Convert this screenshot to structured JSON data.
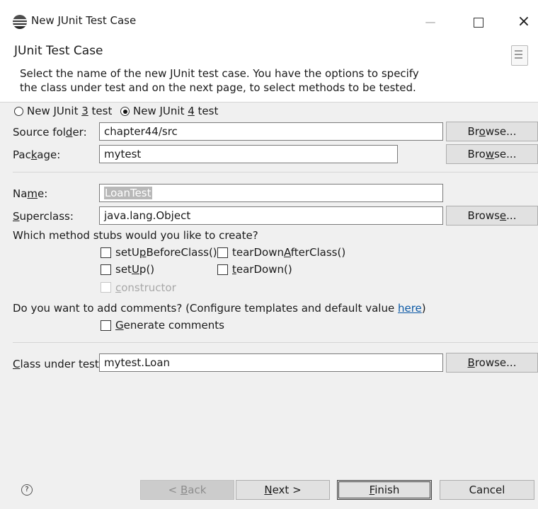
{
  "window": {
    "title": "New JUnit Test Case",
    "min_glyph": "—",
    "close_glyph": "×"
  },
  "header": {
    "title": "JUnit Test Case",
    "description": [
      "Select the name of the new JUnit test case. You have the options to specify",
      "the class under test and on the next page, to select methods to be tested."
    ]
  },
  "version": {
    "junit3": {
      "pre": "New JUnit ",
      "mn": "3",
      "post": " test",
      "selected": false
    },
    "junit4": {
      "pre": "New JUnit ",
      "mn": "4",
      "post": " test",
      "selected": true
    }
  },
  "fields": {
    "source_folder": {
      "label_pre": "Source fol",
      "label_mn": "d",
      "label_post": "er:",
      "value": "chapter44/src",
      "browse": {
        "pre": "Br",
        "mn": "o",
        "post": "wse..."
      }
    },
    "package": {
      "label_pre": "Pac",
      "label_mn": "k",
      "label_post": "age:",
      "value": "mytest",
      "browse": {
        "pre": "Bro",
        "mn": "w",
        "post": "se..."
      }
    },
    "name": {
      "label_pre": "Na",
      "label_mn": "m",
      "label_post": "e:",
      "value": "LoanTest"
    },
    "superclass": {
      "label_pre": "",
      "label_mn": "S",
      "label_post": "uperclass:",
      "value": "java.lang.Object",
      "browse": {
        "pre": "Brows",
        "mn": "e",
        "post": "..."
      }
    },
    "class_under_test": {
      "label_pre": "",
      "label_mn": "C",
      "label_post": "lass under test:",
      "value": "mytest.Loan",
      "browse": {
        "pre": "",
        "mn": "B",
        "post": "rowse..."
      }
    }
  },
  "stubs": {
    "question": "Which method stubs would you like to create?",
    "setUpBeforeClass": {
      "pre": "setU",
      "mn": "p",
      "post": "BeforeClass()",
      "checked": false
    },
    "tearDownAfterClass": {
      "pre": "tearDown",
      "mn": "A",
      "post": "fterClass()",
      "checked": false
    },
    "setUp": {
      "pre": "set",
      "mn": "U",
      "post": "p()",
      "checked": false
    },
    "tearDown": {
      "pre": "",
      "mn": "t",
      "post": "earDown()",
      "checked": false
    },
    "constructor": {
      "pre": "",
      "mn": "c",
      "post": "onstructor",
      "checked": false,
      "enabled": false
    }
  },
  "comments": {
    "question": "Do you want to add comments? (Configure templates and default value ",
    "link": "here",
    "question_end": ")",
    "generate": {
      "pre": "",
      "mn": "G",
      "post": "enerate comments",
      "checked": false
    }
  },
  "footer": {
    "help_glyph": "?",
    "back": {
      "pre": "< ",
      "mn": "B",
      "post": "ack",
      "enabled": false
    },
    "next": {
      "pre": "",
      "mn": "N",
      "post": "ext >"
    },
    "finish": {
      "pre": "",
      "mn": "F",
      "post": "inish"
    },
    "cancel": "Cancel"
  }
}
